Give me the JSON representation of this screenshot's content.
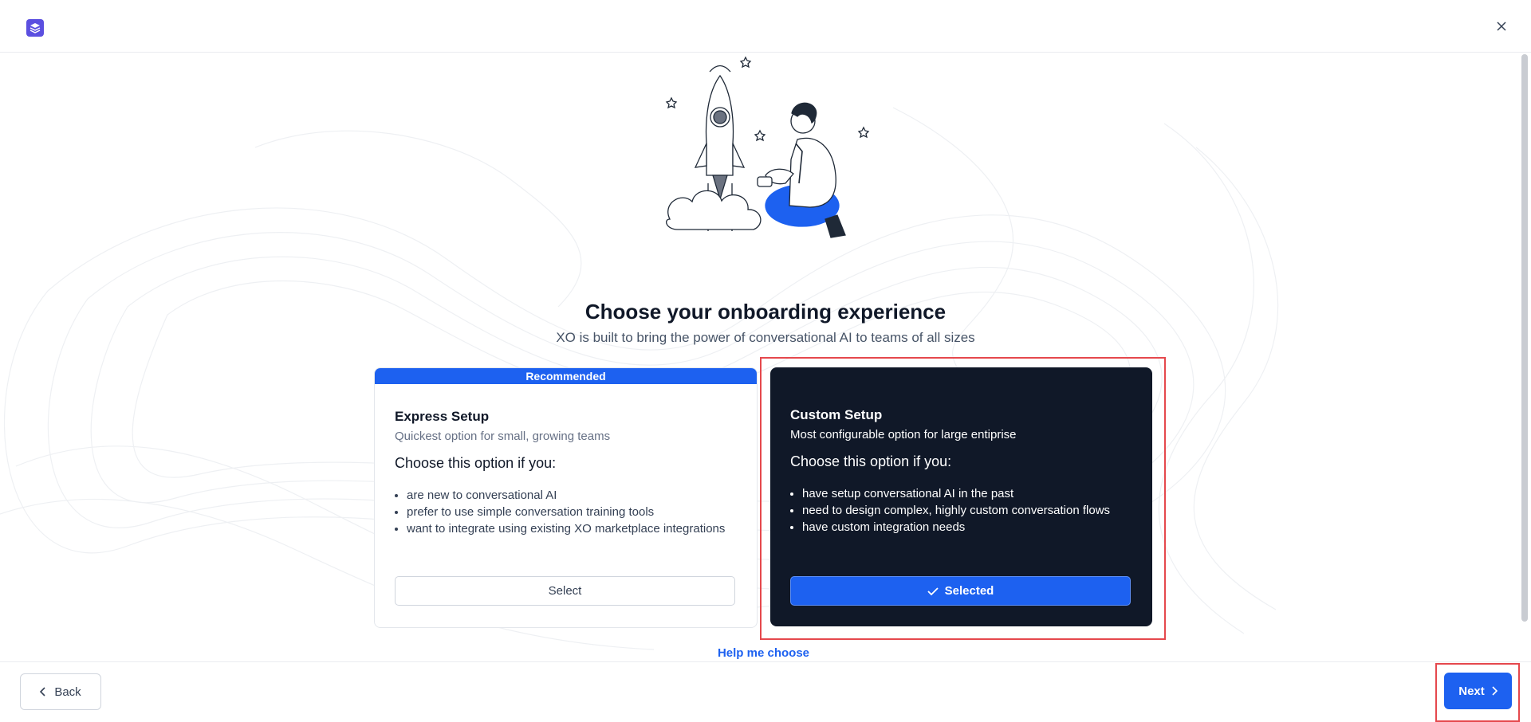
{
  "header": {
    "logo_icon": "layers-logo-icon",
    "close_icon": "close-icon"
  },
  "page": {
    "title": "Choose your onboarding experience",
    "subtitle": "XO is built to bring the power of conversational AI to teams of all sizes"
  },
  "options": [
    {
      "badge": "Recommended",
      "title": "Express Setup",
      "subtitle": "Quickest option for small, growing teams",
      "choose_label": "Choose this option if you:",
      "bullets": [
        "are new to conversational AI",
        "prefer to use simple conversation training tools",
        "want to integrate using existing XO marketplace integrations"
      ],
      "button_label": "Select",
      "selected": false
    },
    {
      "title": "Custom Setup",
      "subtitle": "Most configurable option for large entiprise",
      "choose_label": "Choose this option if you:",
      "bullets": [
        "have setup conversational AI in the past",
        "need to design complex, highly custom conversation flows",
        "have custom integration needs"
      ],
      "button_label": "Selected",
      "button_icon": "check-icon",
      "selected": true
    }
  ],
  "help_link": "Help me choose",
  "footer": {
    "back_label": "Back",
    "next_label": "Next"
  },
  "colors": {
    "primary": "#1d61f0",
    "dark_card": "#101828",
    "highlight": "#e5484d"
  }
}
